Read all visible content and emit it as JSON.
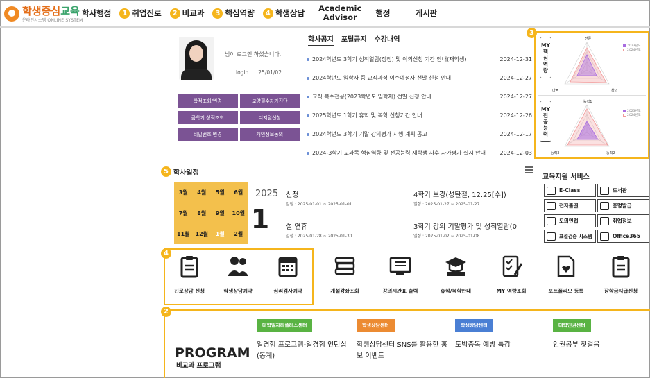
{
  "header": {
    "logo_title_a": "학생중심",
    "logo_title_b": "교육",
    "logo_sub": "온라인시스템 ONLINE SYSTEM",
    "nav": [
      {
        "label": "학사행정",
        "badge": ""
      },
      {
        "label": "취업진로",
        "badge": "1"
      },
      {
        "label": "비교과",
        "badge": "2"
      },
      {
        "label": "핵심역량",
        "badge": "3"
      },
      {
        "label": "학생상담",
        "badge": "4"
      },
      {
        "label_line1": "Academic",
        "label_line2": "Advisor"
      },
      {
        "label": "행정"
      },
      {
        "label": "게시판"
      }
    ]
  },
  "profile": {
    "welcome": "님이 로그인 하셨습니다.",
    "login_label": "login",
    "login_date": "25/01/02",
    "buttons": [
      "학적조회/변경",
      "교양필수자가진단",
      "금학기 성적조회",
      "디지털신청",
      "비밀번호 변경",
      "개인정보동의"
    ]
  },
  "notices": {
    "tabs": [
      "학사공지",
      "포털공지",
      "수강내역"
    ],
    "items": [
      {
        "title": "2024학년도 3학기 성적열람(정정) 및 이의신청 기간 안내(재학생)",
        "date": "2024-12-31"
      },
      {
        "title": "2024학년도 입학자 중 교직과정 이수예정자 선발 신청 안내",
        "date": "2024-12-27"
      },
      {
        "title": "교직 복수전공(2023학년도 입학자) 선발 신청 안내",
        "date": "2024-12-27"
      },
      {
        "title": "2025학년도 1학기 휴학 및 복학 신청기간 안내",
        "date": "2024-12-26"
      },
      {
        "title": " 2024학년도 3학기 기말 강의평가 시행 계획 공고",
        "date": "2024-12-17"
      },
      {
        "title": "2024-3학기 교과목 핵심역량 및 전공능력 재학생 사후 자가평가 실시 안내",
        "date": "2024-12-03"
      }
    ]
  },
  "radar": {
    "badge": "3",
    "core": {
      "tag": [
        "MY",
        "핵",
        "심",
        "역",
        "량"
      ],
      "axes": [
        "전문",
        "나눔",
        "창의"
      ],
      "legend": [
        "2023년도",
        "2024년도"
      ]
    },
    "major": {
      "tag": [
        "MY",
        "전",
        "공",
        "능",
        "력"
      ],
      "axes": [
        "능력1",
        "능력3",
        "능력2"
      ],
      "legend": [
        "2023년도",
        "2024년도"
      ]
    },
    "colors": {
      "series_a": "#a86ce0",
      "series_b": "#f19a9a"
    }
  },
  "schedule": {
    "badge": "5",
    "title": "학사일정",
    "months": [
      "3월",
      "4월",
      "5월",
      "6월",
      "7월",
      "8월",
      "9월",
      "10월",
      "11월",
      "12월",
      "1월",
      "2월"
    ],
    "active_month": "1월",
    "year": "2025",
    "day": "1",
    "events": [
      {
        "title": "신정",
        "date": "일정 : 2025-01-01 ~ 2025-01-01"
      },
      {
        "title": "4학기 보강(성탄절, 12.25[수])",
        "date": "일정 : 2025-01-27 ~ 2025-01-27"
      },
      {
        "title": "설 연휴",
        "date": "일정 : 2025-01-28 ~ 2025-01-30"
      },
      {
        "title": "3학기 강의 기말평가 및 성적열람(0",
        "date": "일정 : 2025-01-02 ~ 2025-01-08"
      }
    ]
  },
  "services": {
    "title": "교육지원 서비스",
    "items": [
      "E-Class",
      "도서관",
      "전자출결",
      "증명발급",
      "모의면접",
      "취업정보",
      "표절검증 시스템",
      "Office365"
    ]
  },
  "quick": {
    "badge": "4",
    "items": [
      "진로상담 신청",
      "학생상담예약",
      "심리검사예약",
      "개설강좌조회",
      "강의시간표 출력",
      "휴학/복학안내",
      "MY 역량조회",
      "포트폴리오 등록",
      "장학금지급신청"
    ]
  },
  "program": {
    "badge": "2",
    "title": "PROGRAM",
    "subtitle": "비교과 프로그램",
    "cards": [
      {
        "chip": "대학일자리플러스센터",
        "color": "#59b343",
        "title": "일경험 프로그램-일경험 인턴십(동계)"
      },
      {
        "chip": "학생상담센터",
        "color": "#ec8b32",
        "title": "학생상담센터 SNS를 활용한 홍보 이벤트"
      },
      {
        "chip": "학생상담센터",
        "color": "#4a7fd4",
        "title": "도박중독 예방 특강"
      },
      {
        "chip": "대학인권센터",
        "color": "#59b343",
        "title": "인권공부 첫걸음"
      }
    ]
  },
  "accent": "#f5b51c",
  "profile_button_color": "#7b5394"
}
